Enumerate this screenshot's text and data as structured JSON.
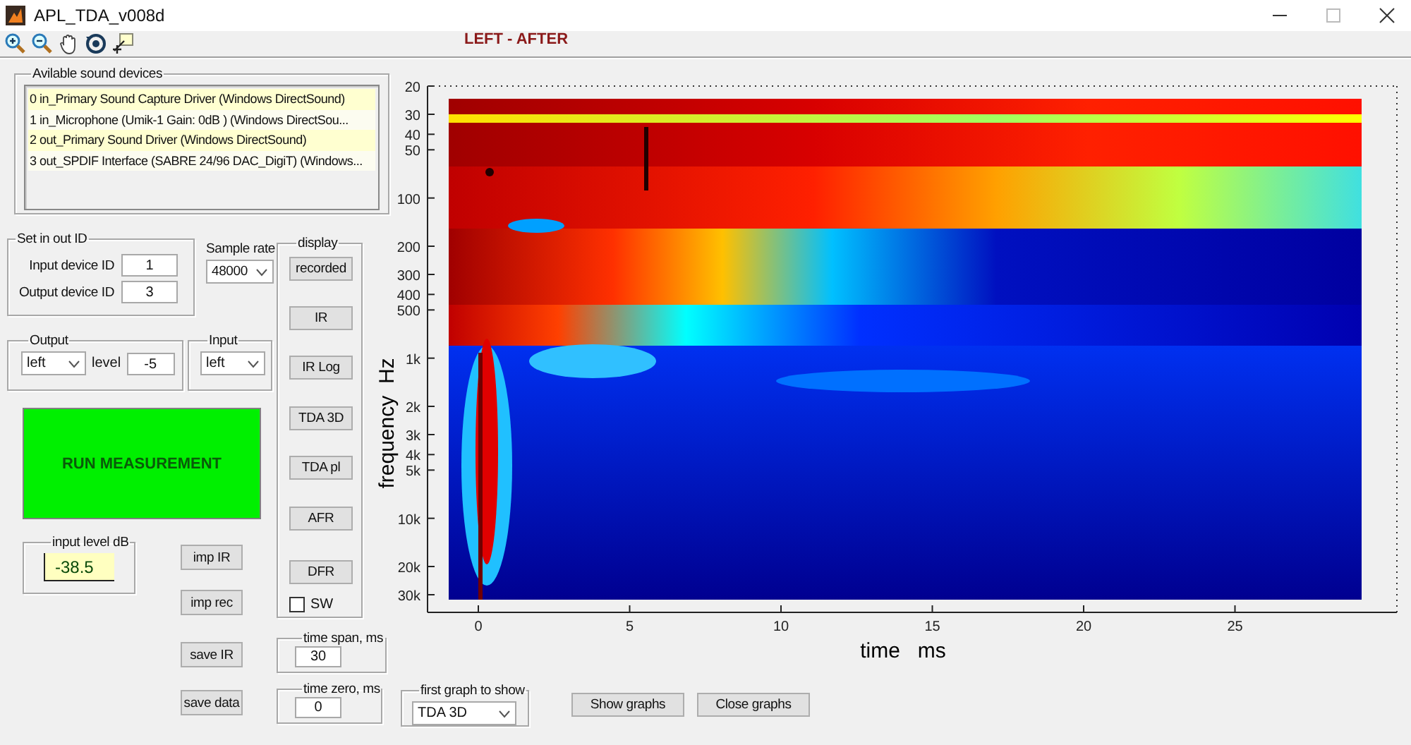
{
  "window": {
    "title": "APL_TDA_v008d"
  },
  "plot_title": "LEFT - AFTER",
  "devices": {
    "label": "Avilable sound devices",
    "items": [
      "0 in_Primary Sound Capture Driver (Windows DirectSound)",
      "1 in_Microphone (Umik-1  Gain:  0dB  ) (Windows DirectSou...",
      "2 out_Primary Sound Driver (Windows DirectSound)",
      "3 out_SPDIF Interface (SABRE 24/96 DAC_DigiT) (Windows..."
    ]
  },
  "set_ids": {
    "label": "Set in out ID",
    "input_label": "Input device ID",
    "input_value": "1",
    "output_label": "Output device ID",
    "output_value": "3"
  },
  "sample_rate": {
    "label": "Sample rate",
    "value": "48000"
  },
  "output": {
    "label": "Output",
    "channel": "left",
    "level_label": "level",
    "level_value": "-5"
  },
  "input": {
    "label": "Input",
    "channel": "left"
  },
  "run_button": "RUN MEASUREMENT",
  "input_level": {
    "label": "input level dB",
    "value": "-38.5"
  },
  "file_buttons": [
    "imp IR",
    "imp rec",
    "save IR",
    "save data"
  ],
  "display": {
    "label": "display",
    "buttons": [
      "recorded",
      "IR",
      "IR Log",
      "TDA 3D",
      "TDA pl",
      "AFR",
      "DFR"
    ],
    "sw": {
      "label": "SW",
      "checked": false
    }
  },
  "time_span": {
    "label": "time span, ms",
    "value": "30"
  },
  "time_zero": {
    "label": "time zero, ms",
    "value": "0"
  },
  "plot": {
    "xlabel": "time   ms",
    "ylabel": "frequency  Hz",
    "xticks": [
      "0",
      "5",
      "10",
      "15",
      "20",
      "25"
    ],
    "yticks": [
      "20",
      "30",
      "40",
      "50",
      "100",
      "200",
      "300",
      "400",
      "500",
      "1k",
      "2k",
      "3k",
      "4k",
      "5k",
      "10k",
      "20k",
      "30k"
    ]
  },
  "first_graph": {
    "label": "first graph to show",
    "value": "TDA 3D"
  },
  "graph_buttons": [
    "Show graphs",
    "Close graphs"
  ]
}
